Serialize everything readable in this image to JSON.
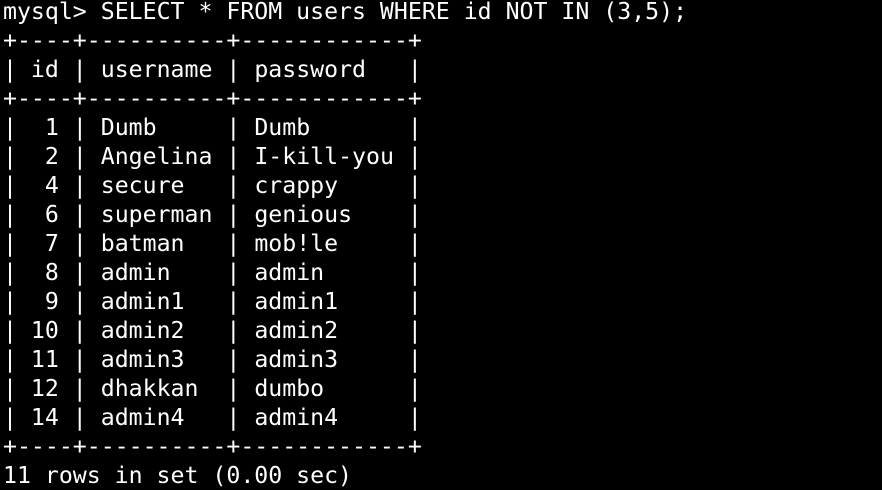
{
  "terminal": {
    "prompt": "mysql>",
    "command": "SELECT * FROM users WHERE id NOT IN (3,5);",
    "border": "+----+----------+------------+",
    "columns": [
      "id",
      "username",
      "password"
    ],
    "rows": [
      {
        "id": "1",
        "username": "Dumb",
        "password": "Dumb"
      },
      {
        "id": "2",
        "username": "Angelina",
        "password": "I-kill-you"
      },
      {
        "id": "4",
        "username": "secure",
        "password": "crappy"
      },
      {
        "id": "6",
        "username": "superman",
        "password": "genious"
      },
      {
        "id": "7",
        "username": "batman",
        "password": "mob!le"
      },
      {
        "id": "8",
        "username": "admin",
        "password": "admin"
      },
      {
        "id": "9",
        "username": "admin1",
        "password": "admin1"
      },
      {
        "id": "10",
        "username": "admin2",
        "password": "admin2"
      },
      {
        "id": "11",
        "username": "admin3",
        "password": "admin3"
      },
      {
        "id": "12",
        "username": "dhakkan",
        "password": "dumbo"
      },
      {
        "id": "14",
        "username": "admin4",
        "password": "admin4"
      }
    ],
    "summary": "11 rows in set (0.00 sec)"
  },
  "colors": {
    "background": "#000000",
    "text": "#ffffff"
  }
}
